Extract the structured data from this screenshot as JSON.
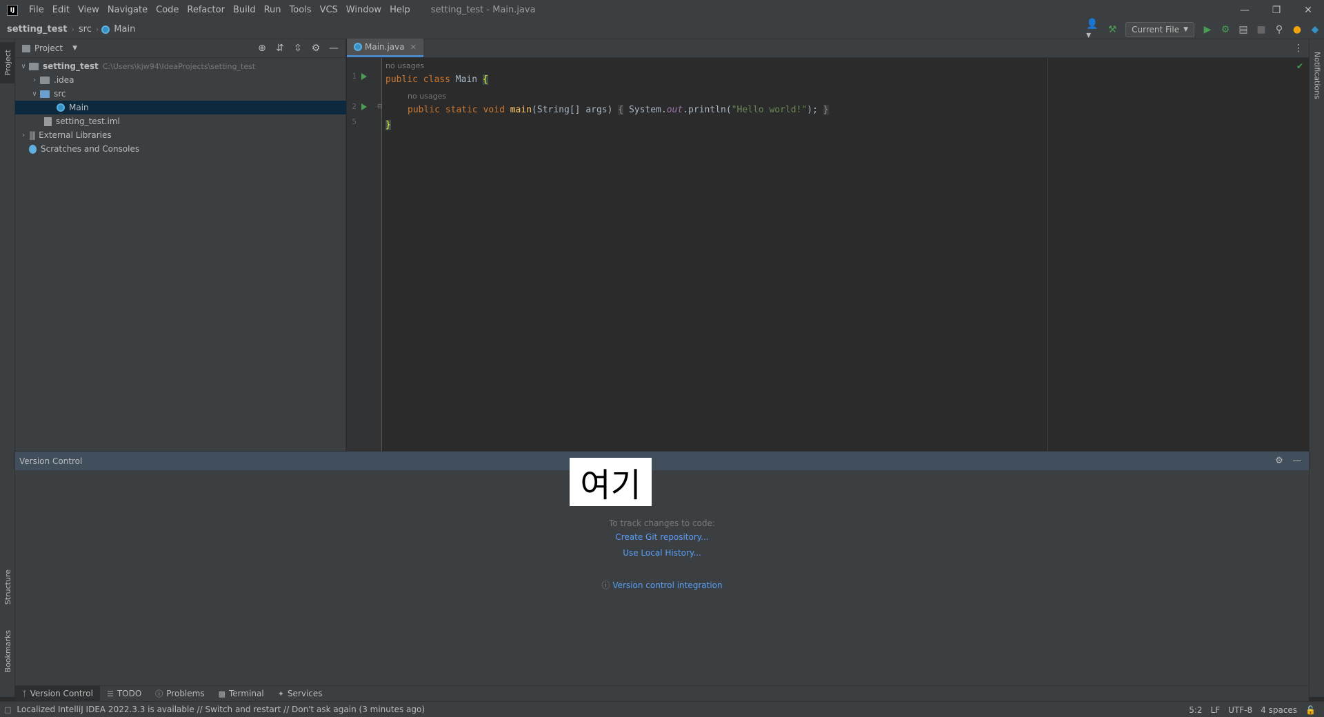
{
  "menu": {
    "logo": "IJ",
    "items": [
      "File",
      "Edit",
      "View",
      "Navigate",
      "Code",
      "Refactor",
      "Build",
      "Run",
      "Tools",
      "VCS",
      "Window",
      "Help"
    ],
    "window_title": "setting_test - Main.java"
  },
  "navbar": {
    "project": "setting_test",
    "src": "src",
    "file": "Main",
    "run_config": "Current File"
  },
  "left_stripe": {
    "project": "Project",
    "structure": "Structure",
    "bookmarks": "Bookmarks"
  },
  "right_stripe": {
    "notifications": "Notifications"
  },
  "project_panel": {
    "title": "Project",
    "tree": {
      "root": "setting_test",
      "root_path": "C:\\Users\\kjw94\\IdeaProjects\\setting_test",
      "idea": ".idea",
      "src": "src",
      "main": "Main",
      "iml": "setting_test.iml",
      "ext_libs": "External Libraries",
      "scratches": "Scratches and Consoles"
    }
  },
  "editor": {
    "tab": "Main.java",
    "line_numbers": [
      "1",
      "2",
      "5"
    ],
    "usages_hint": "no usages",
    "code": {
      "l1_kw1": "public",
      "l1_kw2": "class",
      "l1_name": "Main",
      "l1_brace": "{",
      "l2_kw1": "public",
      "l2_kw2": "static",
      "l2_kw3": "void",
      "l2_fn": "main",
      "l2_params": "(String[] args)",
      "l2_fold_open": "{",
      "l2_sys": "System.",
      "l2_out": "out",
      "l2_call": ".println(",
      "l2_str": "\"Hello world!\"",
      "l2_end": ");",
      "l2_fold_close": "}",
      "l5_brace": "}"
    }
  },
  "version_control": {
    "title": "Version Control",
    "overlay": "여기",
    "track_text": "To track changes to code:",
    "create_git": "Create Git repository...",
    "local_history": "Use Local History...",
    "integration": "Version control integration"
  },
  "bottom_tabs": [
    "Version Control",
    "TODO",
    "Problems",
    "Terminal",
    "Services"
  ],
  "status": {
    "message": "Localized IntelliJ IDEA 2022.3.3 is available // Switch and restart // Don't ask again (3 minutes ago)",
    "position": "5:2",
    "line_sep": "LF",
    "encoding": "UTF-8",
    "indent": "4 spaces"
  },
  "colors": {
    "background": "#2b2b2b",
    "panel": "#3c3f41",
    "accent": "#4a88c7",
    "link": "#589df6",
    "run_green": "#499c54"
  }
}
